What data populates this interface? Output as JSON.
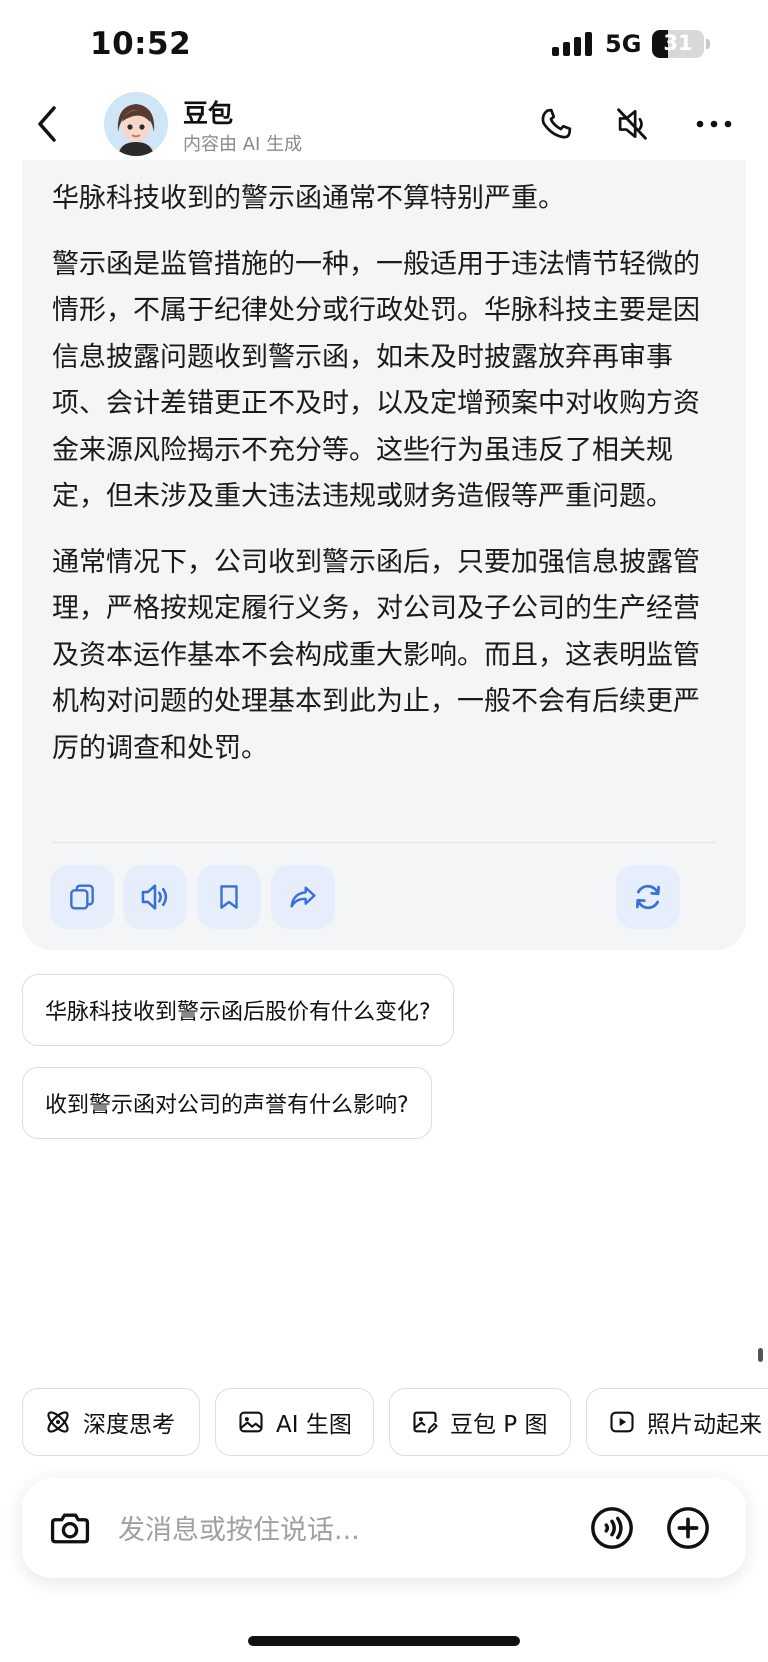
{
  "status": {
    "time": "10:52",
    "network": "5G",
    "battery": "31",
    "battery_level": 0.31
  },
  "header": {
    "name": "豆包",
    "subtitle": "内容由 AI 生成",
    "icons": [
      "chevron-left-icon",
      "phone-icon",
      "speaker-muted-icon",
      "more-dots-icon"
    ]
  },
  "message": {
    "paragraphs": [
      "华脉科技收到的警示函通常不算特别严重。",
      "警示函是监管措施的一种，一般适用于违法情节轻微的情形，不属于纪律处分或行政处罚。华脉科技主要是因信息披露问题收到警示函，如未及时披露放弃再审事项、会计差错更正不及时，以及定增预案中对收购方资金来源风险揭示不充分等。这些行为虽违反了相关规定，但未涉及重大违法违规或财务造假等严重问题。",
      "通常情况下，公司收到警示函后，只要加强信息披露管理，严格按规定履行义务，对公司及子公司的生产经营及资本运作基本不会构成重大影响。而且，这表明监管机构对问题的处理基本到此为止，一般不会有后续更严厉的调查和处罚。"
    ],
    "actions": [
      "copy-icon",
      "speaker-icon",
      "bookmark-icon",
      "share-icon",
      "refresh-icon"
    ]
  },
  "suggestions": [
    "华脉科技收到警示函后股价有什么变化?",
    "收到警示函对公司的声誉有什么影响?"
  ],
  "tools": [
    {
      "label": "深度思考",
      "icon": "atom-icon"
    },
    {
      "label": "AI 生图",
      "icon": "image-icon"
    },
    {
      "label": "豆包 P 图",
      "icon": "image-edit-icon"
    },
    {
      "label": "照片动起来",
      "icon": "play-icon"
    }
  ],
  "input": {
    "placeholder": "发消息或按住说话...",
    "icons": [
      "camera-icon",
      "voice-icon",
      "plus-icon"
    ]
  },
  "colors": {
    "accent": "#3a6fd8",
    "bubble_bg": "#f4f5f7",
    "action_bg": "#e6eefb"
  }
}
